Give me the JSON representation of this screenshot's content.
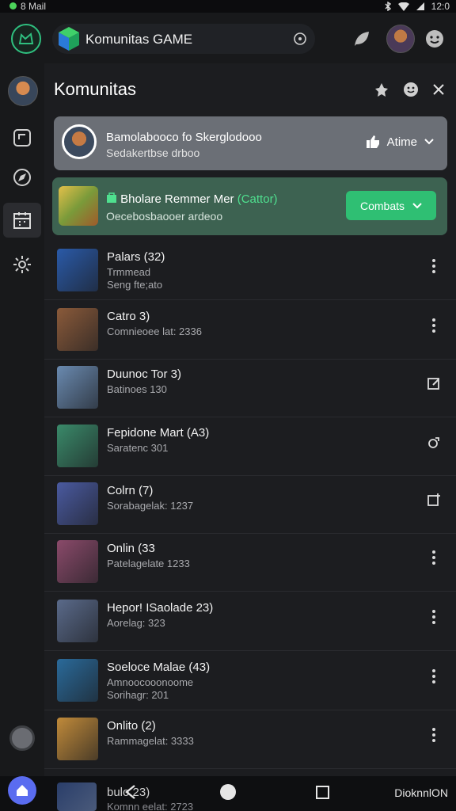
{
  "status_bar": {
    "left_text": "8 Mail",
    "time": "12:0"
  },
  "top_bar": {
    "app_title": "Komunitas GAME"
  },
  "panel": {
    "title": "Komunitas",
    "card_user": {
      "line1": "Bamolabooco fo Skerglodooo",
      "line2": "Sedakertbse drboo",
      "action_label": "Atime"
    },
    "card_promo": {
      "line1": "Bholare Remmer Mer",
      "line1_highlight": "(Cattor)",
      "line2": "Oecebosbaooer ardeoo",
      "button_label": "Combats"
    }
  },
  "list": [
    {
      "name": "Palars (32)",
      "sub": "Trmmead",
      "sub2": "Seng fte;ato",
      "menu_icon": "more-vert-icon",
      "thumb_color": "#2a5aa8"
    },
    {
      "name": "Catro 3)",
      "sub": "Comnieoee lat: 2336",
      "sub2": "",
      "menu_icon": "more-vert-icon",
      "thumb_color": "#8a5a3a"
    },
    {
      "name": "Duunoc Tor 3)",
      "sub": "Batinoes 130",
      "sub2": "",
      "menu_icon": "edit-square-icon",
      "thumb_color": "#6a8ab0"
    },
    {
      "name": "Fepidone Mart (A3)",
      "sub": "Saratenc 301",
      "sub2": "",
      "menu_icon": "share-icon",
      "thumb_color": "#3a8a6a"
    },
    {
      "name": "Colrn (7)",
      "sub": "Sorabagelak: 1237",
      "sub2": "",
      "menu_icon": "add-box-icon",
      "thumb_color": "#4a5aa0"
    },
    {
      "name": "Onlin (33",
      "sub": "Patelagelate 1233",
      "sub2": "",
      "menu_icon": "more-vert-icon",
      "thumb_color": "#8a4a6a"
    },
    {
      "name": "Hepor! ISaolade 23)",
      "sub": "Aorelag: 323",
      "sub2": "",
      "menu_icon": "more-vert-icon",
      "thumb_color": "#5a6a8a"
    },
    {
      "name": "Soeloce Malae (43)",
      "sub": "Amnoocooonoome",
      "sub2": "Sorihagr: 201",
      "menu_icon": "more-vert-icon",
      "thumb_color": "#2a6a9a"
    },
    {
      "name": "Onlito (2)",
      "sub": "Rammagelat: 3333",
      "sub2": "",
      "menu_icon": "more-vert-icon",
      "thumb_color": "#c08a3a"
    }
  ],
  "nav_bar": {
    "peek_name": "bulo 23)",
    "peek_sub": "Komnn eelat: 2723",
    "right_label": "DioknnlON"
  }
}
